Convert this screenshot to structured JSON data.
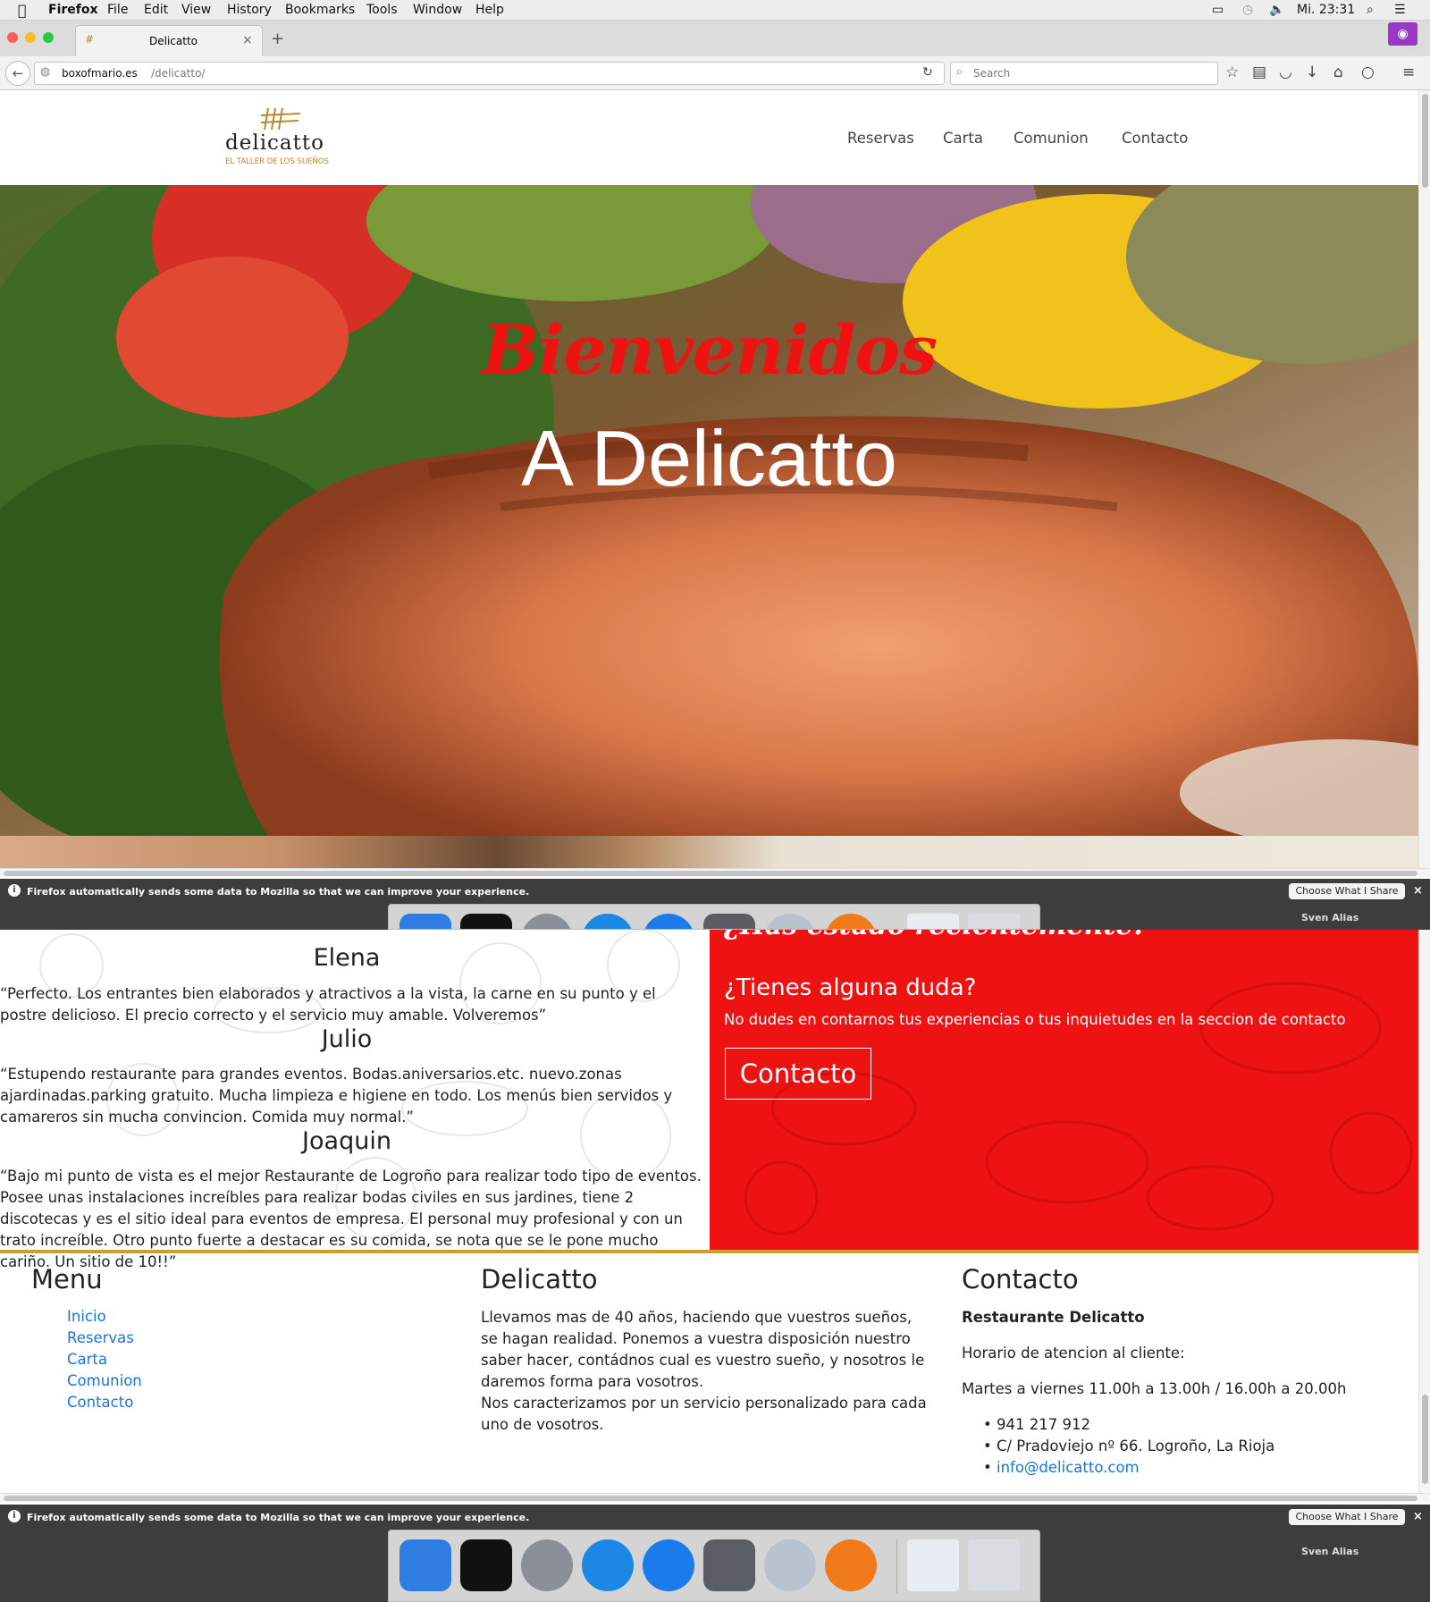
{
  "menubar": {
    "app": "Firefox",
    "items": [
      "File",
      "Edit",
      "View",
      "History",
      "Bookmarks",
      "Tools",
      "Window",
      "Help"
    ],
    "clock": "Mi. 23:31"
  },
  "browser": {
    "tab_title": "Delicatto",
    "url_domain": "boxofmario.es",
    "url_path": "/delicatto/",
    "search_placeholder": "Search"
  },
  "site": {
    "logo_name": "delicatto",
    "logo_tagline": "EL TALLER DE LOS SUEÑOS",
    "nav": [
      "Reservas",
      "Carta",
      "Comunion",
      "Contacto"
    ],
    "hero_script": "Bienvenidos",
    "hero_title": "A Delicatto"
  },
  "notice": {
    "text": "Firefox automatically sends some data to Mozilla so that we can improve your experience.",
    "button": "Choose What I Share",
    "user": "Sven Alias"
  },
  "reviews": [
    {
      "name": "Elena",
      "text": "“Perfecto. Los entrantes bien elaborados y atractivos a la vista, la carne en su punto y el postre delicioso. El precio correcto y el servicio muy amable. Volveremos”"
    },
    {
      "name": "Julio",
      "text": "“Estupendo restaurante para grandes eventos. Bodas.aniversarios.etc. nuevo.zonas ajardinadas.parking gratuito. Mucha limpieza e higiene en todo. Los menús bien servidos y camareros sin mucha convincion. Comida muy normal.”"
    },
    {
      "name": "Joaquin",
      "text": "“Bajo mi punto de vista es el mejor Restaurante de Logroño para realizar todo tipo de eventos. Posee unas instalaciones increíbles para realizar bodas civiles en sus jardines, tiene 2 discotecas y es el sitio ideal para eventos de empresa. El personal muy profesional y con un trato increíble. Otro punto fuerte a destacar es su comida, se nota que se le pone mucho cariño. Un sitio de 10!!”"
    }
  ],
  "cta": {
    "partial": "¿Has estado recientemente?",
    "heading": "¿Tienes alguna duda?",
    "text": "No dudes en contarnos tus experiencias o tus inquietudes en la seccion de contacto",
    "button": "Contacto"
  },
  "footer": {
    "menu_title": "Menu",
    "menu_items": [
      "Inicio",
      "Reservas",
      "Carta",
      "Comunion",
      "Contacto"
    ],
    "about_title": "Delicatto",
    "about_p1": "Llevamos mas de 40 años, haciendo que vuestros sueños, se hagan realidad. Ponemos a vuestra disposición nuestro saber hacer, contádnos cual es vuestro sueño, y nosotros le daremos forma para vosotros.",
    "about_p2": "Nos caracterizamos por un servicio personalizado para cada uno de vosotros.",
    "contact_title": "Contacto",
    "contact_name": "Restaurante Delicatto",
    "contact_hours_label": "Horario de atencion al cliente:",
    "contact_hours": "Martes a viernes 11.00h a 13.00h / 16.00h a 20.00h",
    "phone": "941 217 912",
    "address": "C/ Pradoviejo nº 66. Logroño, La Rioja",
    "email": "info@delicatto.com"
  },
  "colors": {
    "accent_red": "#ee1212",
    "link_blue": "#1a73d9",
    "gold": "#c8a032"
  }
}
